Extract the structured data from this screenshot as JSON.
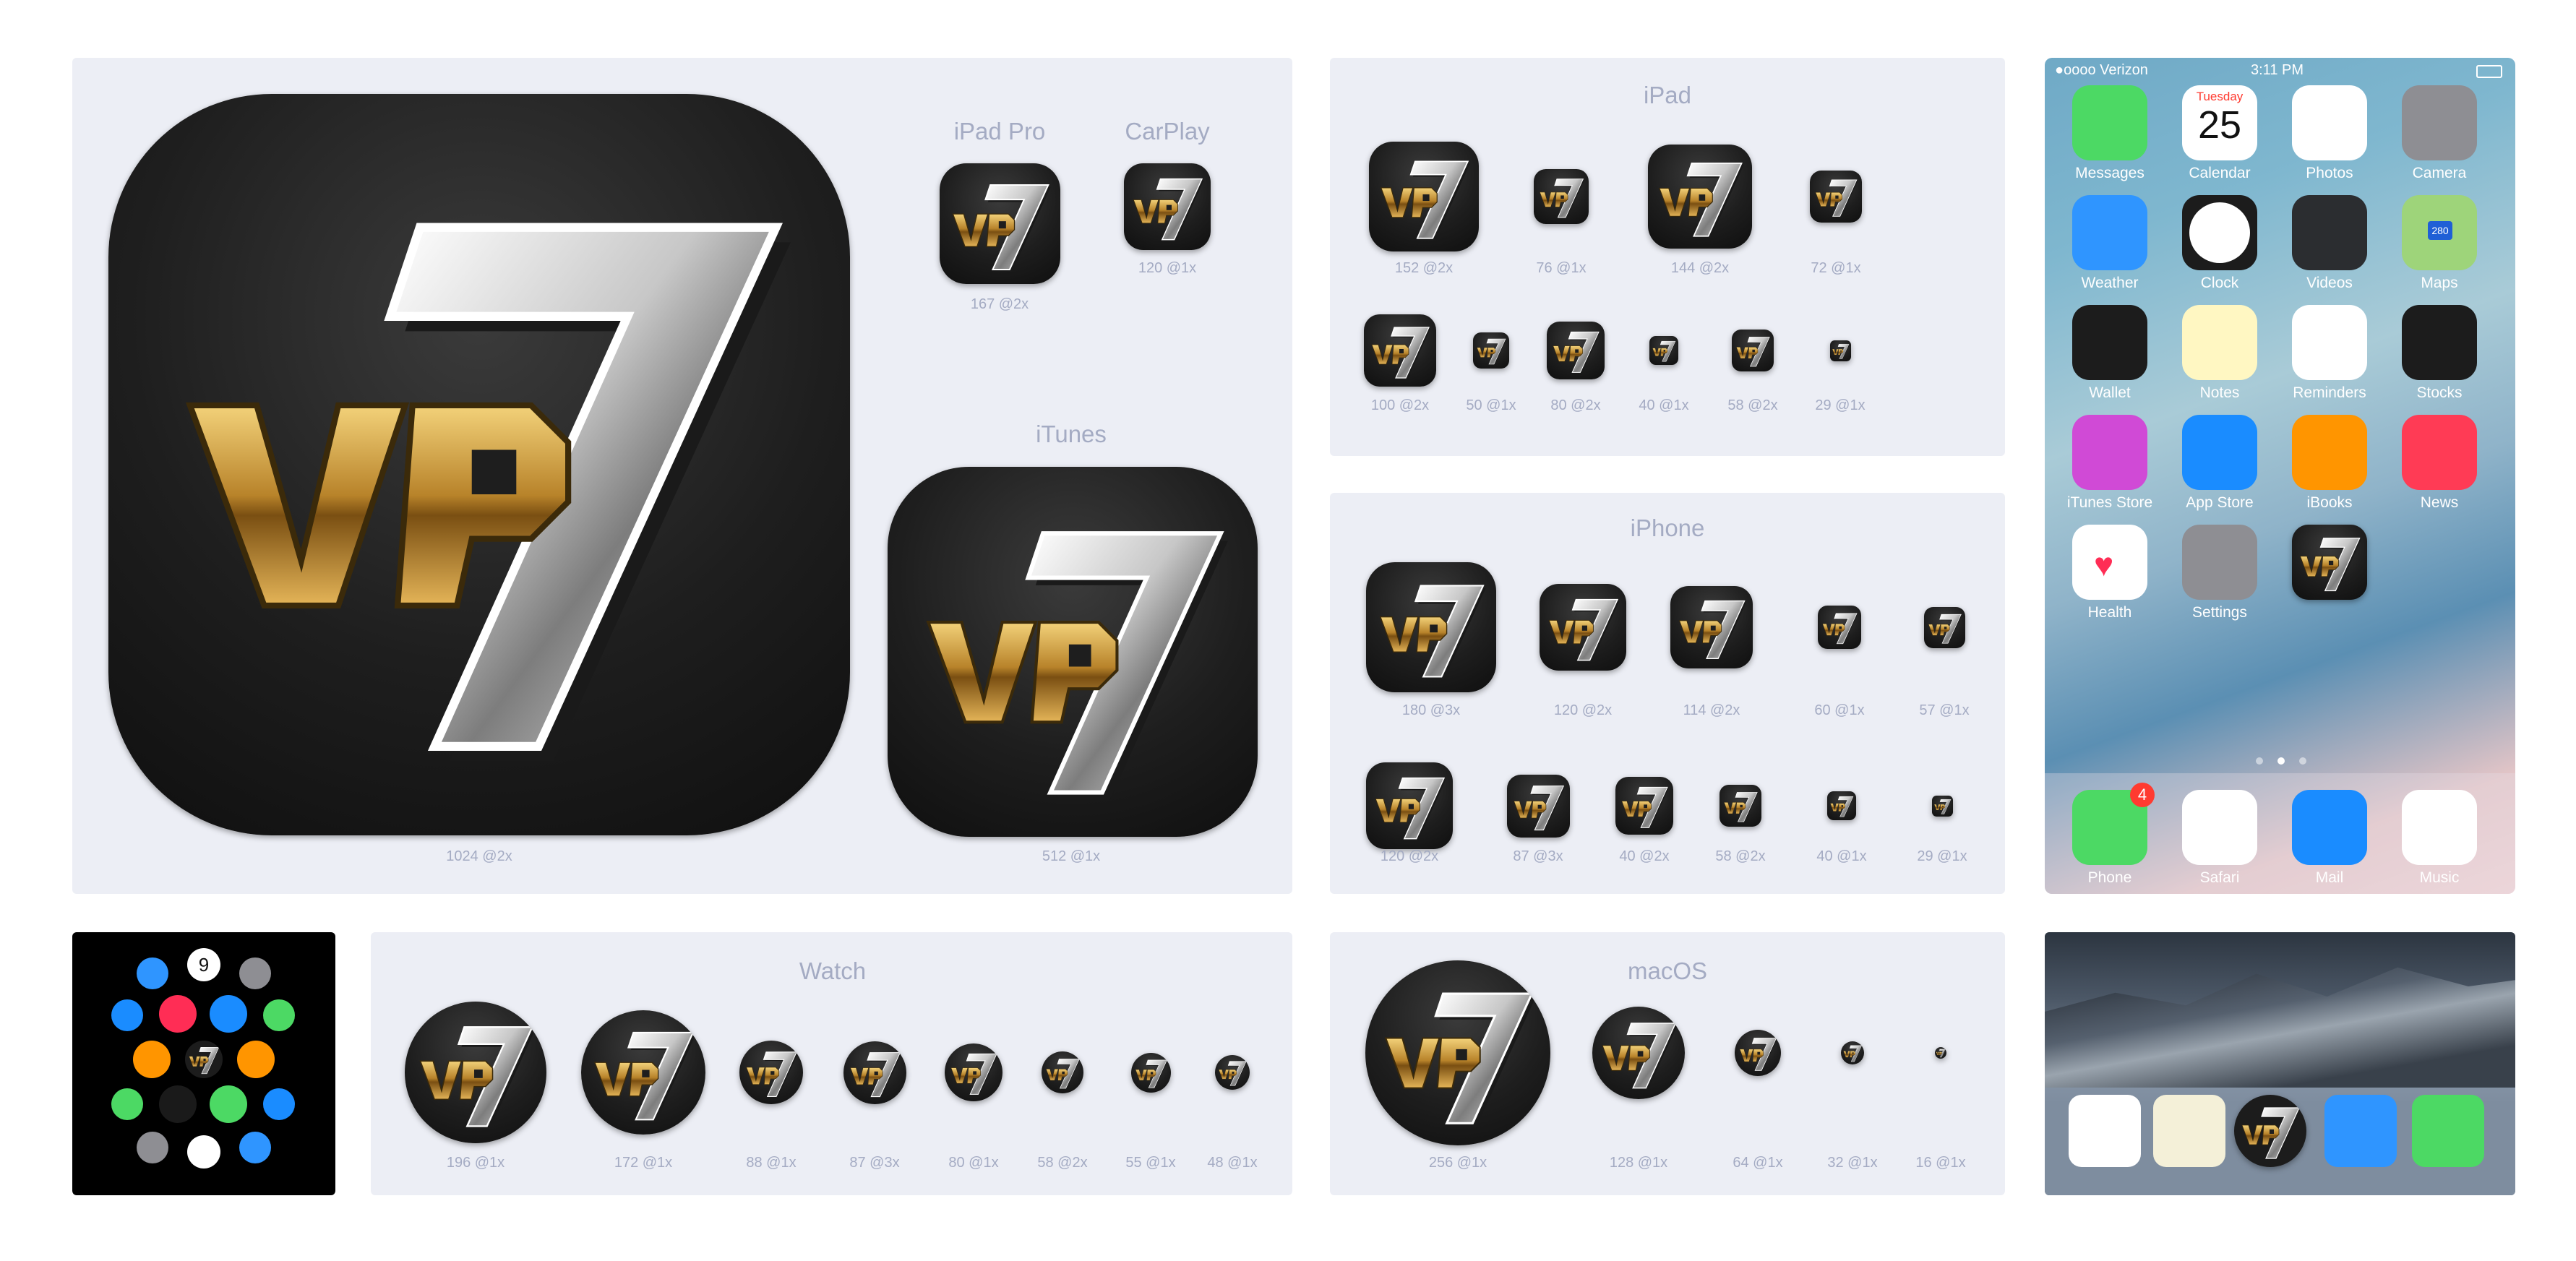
{
  "icon": {
    "text_left": "VP",
    "text_right": "7"
  },
  "main_panel": {
    "big": {
      "caption": "1024 @2x"
    },
    "ipad_pro": {
      "title": "iPad Pro",
      "caption": "167 @2x"
    },
    "carplay": {
      "title": "CarPlay",
      "caption": "120 @1x"
    },
    "itunes": {
      "title": "iTunes",
      "caption": "512 @1x"
    }
  },
  "ipad": {
    "title": "iPad",
    "row1": [
      "152 @2x",
      "76 @1x",
      "144 @2x",
      "72 @1x"
    ],
    "row2": [
      "100 @2x",
      "50 @1x",
      "80 @2x",
      "40 @1x",
      "58 @2x",
      "29 @1x"
    ]
  },
  "iphone": {
    "title": "iPhone",
    "row1": [
      "180 @3x",
      "120 @2x",
      "114 @2x",
      "60 @1x",
      "57 @1x"
    ],
    "row2": [
      "120 @2x",
      "87 @3x",
      "40 @2x",
      "58 @2x",
      "40 @1x",
      "29 @1x"
    ]
  },
  "watch": {
    "title": "Watch",
    "items": [
      "196 @1x",
      "172 @1x",
      "88 @1x",
      "87 @3x",
      "80 @1x",
      "58 @2x",
      "55 @1x",
      "48 @1x"
    ]
  },
  "macos": {
    "title": "macOS",
    "items": [
      "256 @1x",
      "128 @1x",
      "64 @1x",
      "32 @1x",
      "16 @1x"
    ]
  },
  "phone": {
    "carrier": "●oooo Verizon",
    "time": "3:11 PM",
    "calendar_day": "Tuesday",
    "calendar_date": "25",
    "apps": [
      "Messages",
      "Calendar",
      "Photos",
      "Camera",
      "Weather",
      "Clock",
      "Videos",
      "Maps",
      "Wallet",
      "Notes",
      "Reminders",
      "Stocks",
      "iTunes Store",
      "App Store",
      "iBooks",
      "News",
      "Health",
      "Settings"
    ],
    "dock": [
      "Phone",
      "Safari",
      "Mail",
      "Music"
    ],
    "phone_badge": "4",
    "maps_shield": "280"
  },
  "watch_screen": {
    "calendar_date": "9"
  },
  "colors": {
    "panel_bg": "#eceef5",
    "caption": "#a4abc3",
    "gold": "#c9962e",
    "silver": "#d7d7d7",
    "icon_dark": "#1e1e1e",
    "watch_bg": "#000000"
  }
}
